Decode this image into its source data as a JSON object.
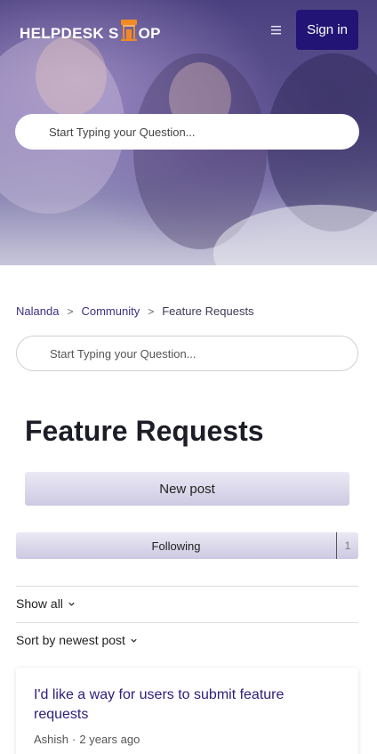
{
  "header": {
    "logo_text_left": "HELPDESK S",
    "logo_text_right": "OP",
    "logo_icon": "shop-building-icon",
    "menu_icon": "hamburger-menu-icon",
    "signin_label": "Sign in",
    "search_placeholder": "Start Typing your Question..."
  },
  "breadcrumb": {
    "items": [
      "Nalanda",
      "Community",
      "Feature Requests"
    ]
  },
  "search": {
    "placeholder": "Start Typing your  Question..."
  },
  "page": {
    "title": "Feature Requests",
    "new_post_label": "New post",
    "following_label": "Following",
    "following_count": "1"
  },
  "filters": {
    "show_label": "Show all",
    "sort_label": "Sort by newest post"
  },
  "posts": [
    {
      "title": "I'd like a way for users to submit feature requests",
      "author": "Ashish",
      "time": "2 years ago"
    }
  ],
  "colors": {
    "brand": "#221474",
    "accent_orange": "#f08a24",
    "link": "#3d2f86"
  }
}
